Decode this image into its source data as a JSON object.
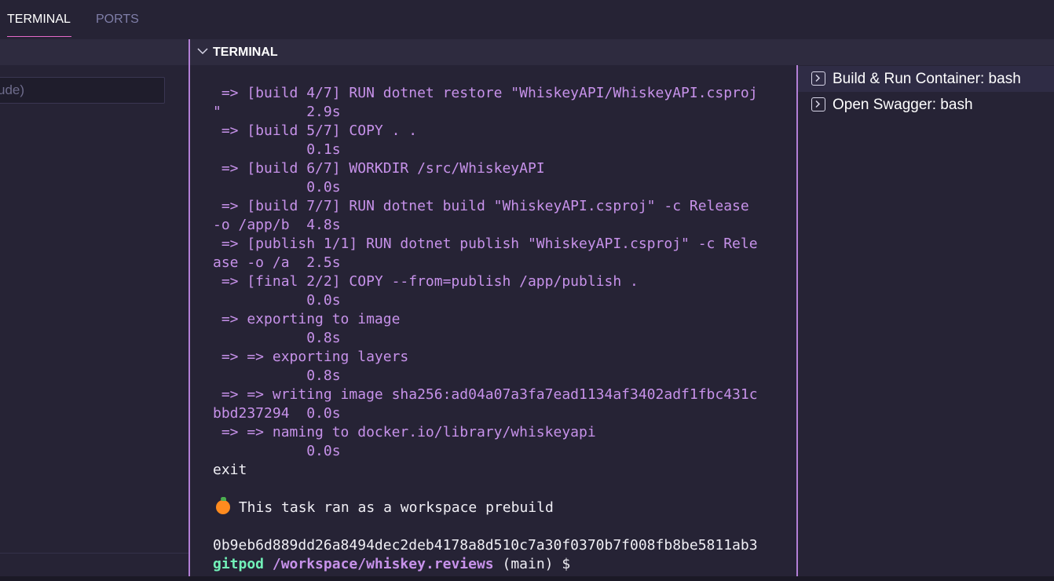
{
  "tabs": [
    {
      "label": "TERMINAL",
      "active": true
    },
    {
      "label": "PORTS",
      "active": false
    }
  ],
  "left": {
    "filter_value": "ude)"
  },
  "terminal": {
    "title": "TERMINAL",
    "lines": [
      {
        "text": " => [build 4/7] RUN dotnet restore \"WhiskeyAPI/WhiskeyAPI.csproj",
        "style": "purple"
      },
      {
        "text": "\"          2.9s",
        "style": "purple"
      },
      {
        "text": " => [build 5/7] COPY . .",
        "style": "purple"
      },
      {
        "text": "           0.1s",
        "style": "purple"
      },
      {
        "text": " => [build 6/7] WORKDIR /src/WhiskeyAPI",
        "style": "purple"
      },
      {
        "text": "           0.0s",
        "style": "purple"
      },
      {
        "text": " => [build 7/7] RUN dotnet build \"WhiskeyAPI.csproj\" -c Release",
        "style": "purple"
      },
      {
        "text": "-o /app/b  4.8s",
        "style": "purple"
      },
      {
        "text": " => [publish 1/1] RUN dotnet publish \"WhiskeyAPI.csproj\" -c Rele",
        "style": "purple"
      },
      {
        "text": "ase -o /a  2.5s",
        "style": "purple"
      },
      {
        "text": " => [final 2/2] COPY --from=publish /app/publish .",
        "style": "purple"
      },
      {
        "text": "           0.0s",
        "style": "purple"
      },
      {
        "text": " => exporting to image",
        "style": "purple"
      },
      {
        "text": "           0.8s",
        "style": "purple"
      },
      {
        "text": " => => exporting layers",
        "style": "purple"
      },
      {
        "text": "           0.8s",
        "style": "purple"
      },
      {
        "text": " => => writing image sha256:ad04a07a3fa7ead1134af3402adf1fbc431c",
        "style": "purple"
      },
      {
        "text": "bbd237294  0.0s",
        "style": "purple"
      },
      {
        "text": " => => naming to docker.io/library/whiskeyapi",
        "style": "purple"
      },
      {
        "text": "           0.0s",
        "style": "purple"
      },
      {
        "text": "exit",
        "style": "white"
      },
      {
        "text": "",
        "style": "white"
      },
      {
        "text": " This task ran as a workspace prebuild",
        "style": "white",
        "icon": "orange-fruit-icon"
      },
      {
        "text": "",
        "style": "white"
      },
      {
        "text": "0b9eb6d889dd26a8494dec2deb4178a8d510c7a30f0370b7f008fb8be5811ab3",
        "style": "white"
      }
    ],
    "prompt": {
      "user": "gitpod",
      "path": "/workspace/whiskey.reviews",
      "branch": "(main) $"
    }
  },
  "tasks": [
    {
      "label": "Build & Run Container: bash",
      "selected": true
    },
    {
      "label": "Open Swagger: bash",
      "selected": false
    }
  ],
  "colors": {
    "background": "#262335",
    "header": "#2e2b3f",
    "accent": "#e468c8",
    "divider": "#b37fd6",
    "output_purple": "#c792ea",
    "prompt_green": "#72f1b8"
  }
}
